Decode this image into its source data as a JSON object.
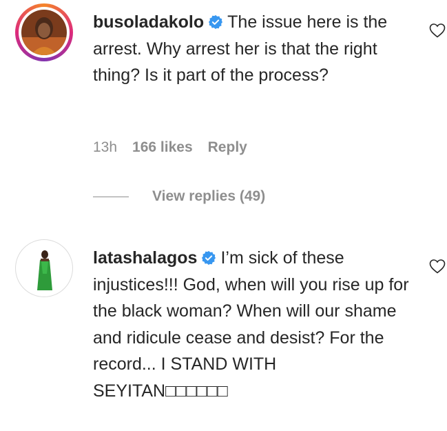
{
  "comments": [
    {
      "username": "busoladakolo",
      "verified": true,
      "text": "The issue here is the arrest. Why arrest her is that the right thing? Is it part of the process?",
      "time": "13h",
      "likes": "166 likes",
      "reply_label": "Reply",
      "view_replies": "View replies (49)"
    },
    {
      "username": "latashalagos",
      "verified": true,
      "text": "I’m sick of these injustices!!! God, when will you rise up for the black woman? When will our shame and ridicule cease and desist? For the record... I STAND WITH SEYITAN□□□□□□"
    }
  ],
  "colors": {
    "verified_blue": "#3897f0",
    "meta_gray": "#8e8e8e",
    "text": "#262626"
  },
  "icons": [
    "verified-badge-icon",
    "heart-icon"
  ]
}
